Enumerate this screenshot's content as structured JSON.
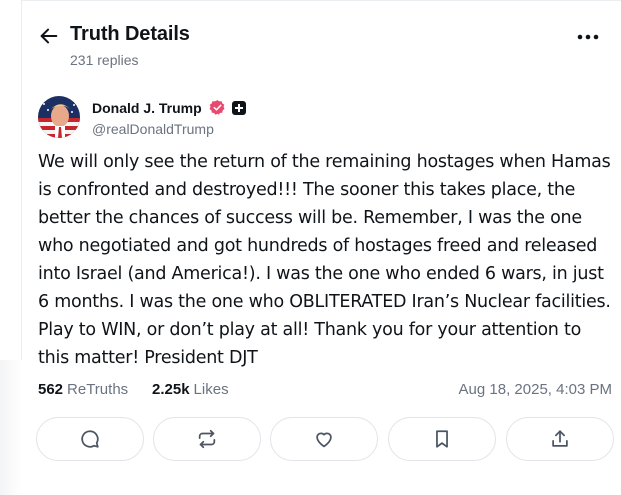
{
  "header": {
    "title": "Truth Details",
    "subtitle": "231 replies"
  },
  "author": {
    "name": "Donald J. Trump",
    "handle": "@realDonaldTrump"
  },
  "post": {
    "text": "We will only see the return of the remaining hostages when Hamas is confronted and destroyed!!! The sooner this takes place, the better the chances of success will be. Remember, I was the one who negotiated and got hundreds of hostages freed and released into Israel (and America!). I was the one who ended 6 wars, in just 6 months. I was the one who OBLITERATED Iran’s Nuclear facilities. Play to WIN, or don’t play at all! Thank you for your attention to this matter!     President DJT"
  },
  "stats": {
    "retruths_count": "562",
    "retruths_label": "ReTruths",
    "likes_count": "2.25k",
    "likes_label": "Likes",
    "timestamp": "Aug 18, 2025, 4:03 PM"
  },
  "actions": [
    {
      "icon": "reply-icon"
    },
    {
      "icon": "retruth-icon"
    },
    {
      "icon": "like-icon"
    },
    {
      "icon": "bookmark-icon"
    },
    {
      "icon": "share-icon"
    }
  ],
  "colors": {
    "text": "#0f1419",
    "muted": "#6b7380",
    "verified": "#e9496f",
    "border": "#e1e4e8"
  }
}
